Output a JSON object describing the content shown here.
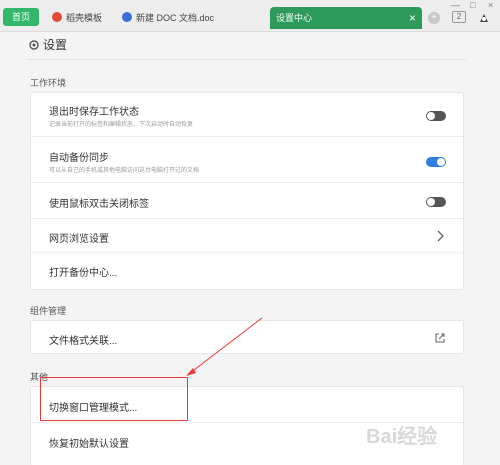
{
  "tabs": {
    "home": "首页",
    "items": [
      {
        "label": "稻壳模板",
        "icon": "wps-red-icon"
      },
      {
        "label": "新建 DOC 文档.doc",
        "icon": "doc-blue-icon"
      }
    ],
    "active": "设置中心",
    "count": "2"
  },
  "header": {
    "title": "设置"
  },
  "sections": {
    "work": "工作环境",
    "components": "组件管理",
    "other": "其他"
  },
  "work_rows": [
    {
      "label": "退出时保存工作状态",
      "desc": "记录当前打开的标签和编辑状态，下次启动时自动恢复",
      "toggle": "off"
    },
    {
      "label": "自动备份同步",
      "desc": "可以从自己的手机或其他电脑访问这台电脑打开过的文档",
      "toggle": "on"
    },
    {
      "label": "使用鼠标双击关闭标签",
      "toggle": "off"
    },
    {
      "label": "网页浏览设置"
    },
    {
      "label": "打开备份中心..."
    }
  ],
  "component_rows": [
    {
      "label": "文件格式关联..."
    }
  ],
  "other_rows": [
    {
      "label": "切换窗口管理模式..."
    },
    {
      "label": "恢复初始默认设置"
    }
  ],
  "watermark": "Bai经验",
  "colors": {
    "accent_green": "#2c9a5a",
    "toggle_on": "#2f7ee0",
    "annotation_red": "#e83b3b"
  }
}
